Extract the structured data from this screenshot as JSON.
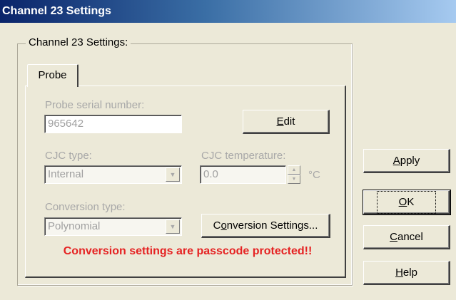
{
  "window": {
    "title": "Channel 23 Settings"
  },
  "group": {
    "label": "Channel 23 Settings:"
  },
  "tabs": [
    {
      "label": "Probe"
    }
  ],
  "probe": {
    "serial_label": "Probe serial number:",
    "serial_value": "965642",
    "edit_button": {
      "pre": "",
      "accel": "E",
      "post": "dit"
    },
    "cjc_type_label": "CJC type:",
    "cjc_type_value": "Internal",
    "cjc_temp_label": "CJC temperature:",
    "cjc_temp_value": "0.0",
    "cjc_temp_unit": "°C",
    "conversion_type_label": "Conversion type:",
    "conversion_type_value": "Polynomial",
    "conversion_settings_button": {
      "pre": "C",
      "accel": "o",
      "post": "nversion Settings..."
    },
    "warning": "Conversion settings are passcode protected!!"
  },
  "side_buttons": {
    "apply": {
      "pre": "",
      "accel": "A",
      "post": "pply"
    },
    "ok": {
      "pre": "",
      "accel": "O",
      "post": "K"
    },
    "cancel": {
      "pre": "",
      "accel": "C",
      "post": "ancel"
    },
    "help": {
      "pre": "",
      "accel": "H",
      "post": "elp"
    }
  },
  "colors": {
    "warning": "#E52222",
    "title_bar_start": "#0A246A",
    "title_bar_end": "#A6CAF0"
  }
}
